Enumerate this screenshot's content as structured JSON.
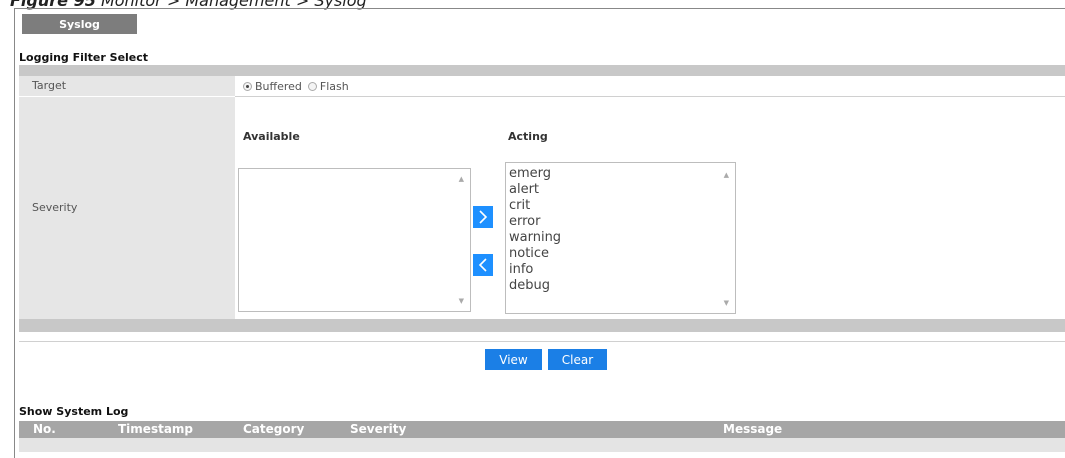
{
  "caption": {
    "label": "Figure 95",
    "text": "Monitor > Management > Syslog"
  },
  "tab": {
    "label": "Syslog"
  },
  "logging_filter": {
    "title": "Logging Filter Select",
    "target": {
      "label": "Target",
      "options": [
        "Buffered",
        "Flash"
      ],
      "selected": "Buffered"
    },
    "severity": {
      "label": "Severity",
      "available_title": "Available",
      "acting_title": "Acting",
      "available_items": [],
      "acting_items": [
        "emerg",
        "alert",
        "crit",
        "error",
        "warning",
        "notice",
        "info",
        "debug"
      ],
      "move_right_icon": "chevron-right-icon",
      "move_left_icon": "chevron-left-icon"
    }
  },
  "buttons": {
    "view": "View",
    "clear": "Clear"
  },
  "system_log": {
    "title": "Show System Log",
    "columns": [
      "No.",
      "Timestamp",
      "Category",
      "Severity",
      "Message"
    ],
    "rows": []
  },
  "colors": {
    "accent": "#1b7fe6",
    "tab_bg": "#7d7d7d",
    "header_bg": "#a6a6a6"
  }
}
